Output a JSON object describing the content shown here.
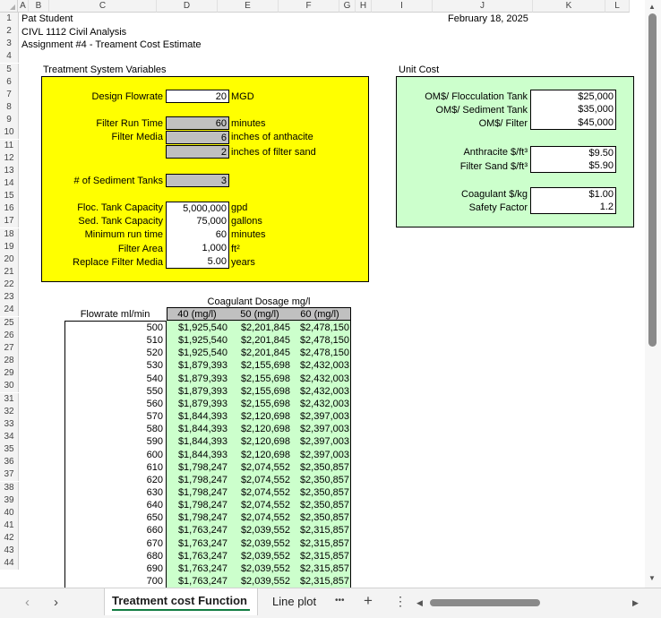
{
  "columns": [
    "A",
    "B",
    "C",
    "D",
    "E",
    "F",
    "G",
    "H",
    "I",
    "J",
    "K",
    "L"
  ],
  "rows": [
    "1",
    "2",
    "3",
    "4",
    "5",
    "6",
    "7",
    "8",
    "9",
    "10",
    "11",
    "12",
    "13",
    "14",
    "15",
    "16",
    "17",
    "18",
    "19",
    "20",
    "21",
    "22",
    "23",
    "24",
    "25",
    "26",
    "27",
    "28",
    "29",
    "30",
    "31",
    "32",
    "33",
    "34",
    "35",
    "36",
    "37",
    "38",
    "39",
    "40",
    "41",
    "42",
    "43",
    "44"
  ],
  "header": {
    "name": "Pat Student",
    "course": "CIVL 1112 Civil Analysis",
    "assignment": "Assignment #4 - Treament Cost Estimate",
    "date": "February 18, 2025"
  },
  "variables": {
    "title": "Treatment System Variables",
    "design_flowrate_label": "Design Flowrate",
    "design_flowrate": "20",
    "design_flowrate_unit": "MGD",
    "filter_run_time_label": "Filter Run Time",
    "filter_run_time": "60",
    "filter_run_time_unit": "minutes",
    "filter_media_label": "Filter Media",
    "filter_media_anthracite": "6",
    "filter_media_anthracite_unit": "inches of anthacite",
    "filter_media_sand": "2",
    "filter_media_sand_unit": "inches of filter sand",
    "sediment_tanks_label": "# of Sediment Tanks",
    "sediment_tanks": "3",
    "floc_capacity_label": "Floc. Tank Capacity",
    "floc_capacity": "5,000,000",
    "floc_capacity_unit": "gpd",
    "sed_capacity_label": "Sed. Tank Capacity",
    "sed_capacity": "75,000",
    "sed_capacity_unit": "gallons",
    "min_run_label": "Minimum run time",
    "min_run": "60",
    "min_run_unit": "minutes",
    "filter_area_label": "Filter Area",
    "filter_area": "1,000",
    "filter_area_unit": "ft²",
    "replace_media_label": "Replace Filter Media",
    "replace_media": "5.00",
    "replace_media_unit": "years"
  },
  "unit_cost": {
    "title": "Unit Cost",
    "floc_label": "OM$/ Flocculation Tank",
    "floc": "$25,000",
    "sed_label": "OM$/ Sediment Tank",
    "sed": "$35,000",
    "filter_label": "OM$/ Filter",
    "filter": "$45,000",
    "anthracite_label": "Anthracite $/ft³",
    "anthracite": "$9.50",
    "sand_label": "Filter Sand $/ft³",
    "sand": "$5.90",
    "coagulant_label": "Coagulant $/kg",
    "coagulant": "$1.00",
    "safety_label": "Safety Factor",
    "safety": "1.2"
  },
  "cost_table": {
    "title": "Coagulant Dosage mg/l",
    "flowrate_header": "Flowrate ml/min",
    "dosage_headers": [
      "40 (mg/l)",
      "50 (mg/l)",
      "60 (mg/l)"
    ],
    "rows": [
      [
        "500",
        "$1,925,540",
        "$2,201,845",
        "$2,478,150"
      ],
      [
        "510",
        "$1,925,540",
        "$2,201,845",
        "$2,478,150"
      ],
      [
        "520",
        "$1,925,540",
        "$2,201,845",
        "$2,478,150"
      ],
      [
        "530",
        "$1,879,393",
        "$2,155,698",
        "$2,432,003"
      ],
      [
        "540",
        "$1,879,393",
        "$2,155,698",
        "$2,432,003"
      ],
      [
        "550",
        "$1,879,393",
        "$2,155,698",
        "$2,432,003"
      ],
      [
        "560",
        "$1,879,393",
        "$2,155,698",
        "$2,432,003"
      ],
      [
        "570",
        "$1,844,393",
        "$2,120,698",
        "$2,397,003"
      ],
      [
        "580",
        "$1,844,393",
        "$2,120,698",
        "$2,397,003"
      ],
      [
        "590",
        "$1,844,393",
        "$2,120,698",
        "$2,397,003"
      ],
      [
        "600",
        "$1,844,393",
        "$2,120,698",
        "$2,397,003"
      ],
      [
        "610",
        "$1,798,247",
        "$2,074,552",
        "$2,350,857"
      ],
      [
        "620",
        "$1,798,247",
        "$2,074,552",
        "$2,350,857"
      ],
      [
        "630",
        "$1,798,247",
        "$2,074,552",
        "$2,350,857"
      ],
      [
        "640",
        "$1,798,247",
        "$2,074,552",
        "$2,350,857"
      ],
      [
        "650",
        "$1,798,247",
        "$2,074,552",
        "$2,350,857"
      ],
      [
        "660",
        "$1,763,247",
        "$2,039,552",
        "$2,315,857"
      ],
      [
        "670",
        "$1,763,247",
        "$2,039,552",
        "$2,315,857"
      ],
      [
        "680",
        "$1,763,247",
        "$2,039,552",
        "$2,315,857"
      ],
      [
        "690",
        "$1,763,247",
        "$2,039,552",
        "$2,315,857"
      ],
      [
        "700",
        "$1,763,247",
        "$2,039,552",
        "$2,315,857"
      ]
    ]
  },
  "tabs": {
    "active": "Treatment cost Function",
    "second": "Line plot",
    "more": "•••",
    "add": "+",
    "options": "⋮"
  },
  "colors": {
    "yellow": "#ffff00",
    "mint": "#ccffcc",
    "grey": "#c0c0c0",
    "active_tab_underline": "#107c41"
  }
}
